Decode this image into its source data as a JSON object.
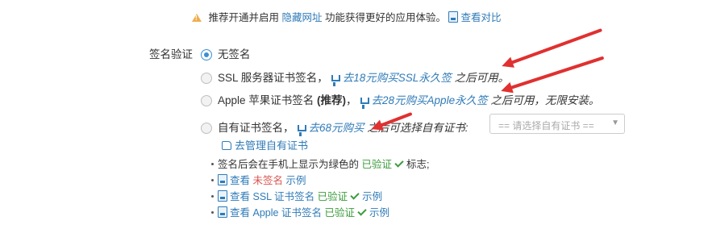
{
  "notice": {
    "prefix": "推荐开通并启用",
    "link": "隐藏网址",
    "suffix": "功能获得更好的应用体验。",
    "compare": "查看对比"
  },
  "signing": {
    "label": "签名验证",
    "options": [
      {
        "label": "无签名",
        "checked": true
      },
      {
        "label": "SSL 服务器证书签名，",
        "buy": "去18元购买SSL永久签",
        "after": "之后可用。",
        "checked": false
      },
      {
        "label_prefix": "Apple 苹果证书签名 ",
        "label_bold": "(推荐)",
        "label_suffix": "，",
        "buy": "去28元购买Apple永久签",
        "after": "之后可用，无限安装。",
        "checked": false
      },
      {
        "label": "自有证书签名，",
        "buy": "去68元购买",
        "after": "之后可选择自有证书:",
        "checked": false
      }
    ],
    "select_placeholder": "== 请选择自有证书 ==",
    "manage_link": "去管理自有证书"
  },
  "notes": {
    "line1_a": "签名后会在手机上显示为绿色的",
    "line1_verified": "已验证",
    "line1_b": "标志;",
    "view": "查看",
    "unsigned": "未签名",
    "example": "示例",
    "ssl_cert": "SSL 证书签名",
    "apple_cert": "Apple 证书签名",
    "verified": "已验证"
  },
  "colors": {
    "link": "#2f7bb8",
    "verified": "#3c9b3c",
    "unsigned": "#d9534f",
    "arrow": "#e03030",
    "warning": "#f0ad4e"
  }
}
